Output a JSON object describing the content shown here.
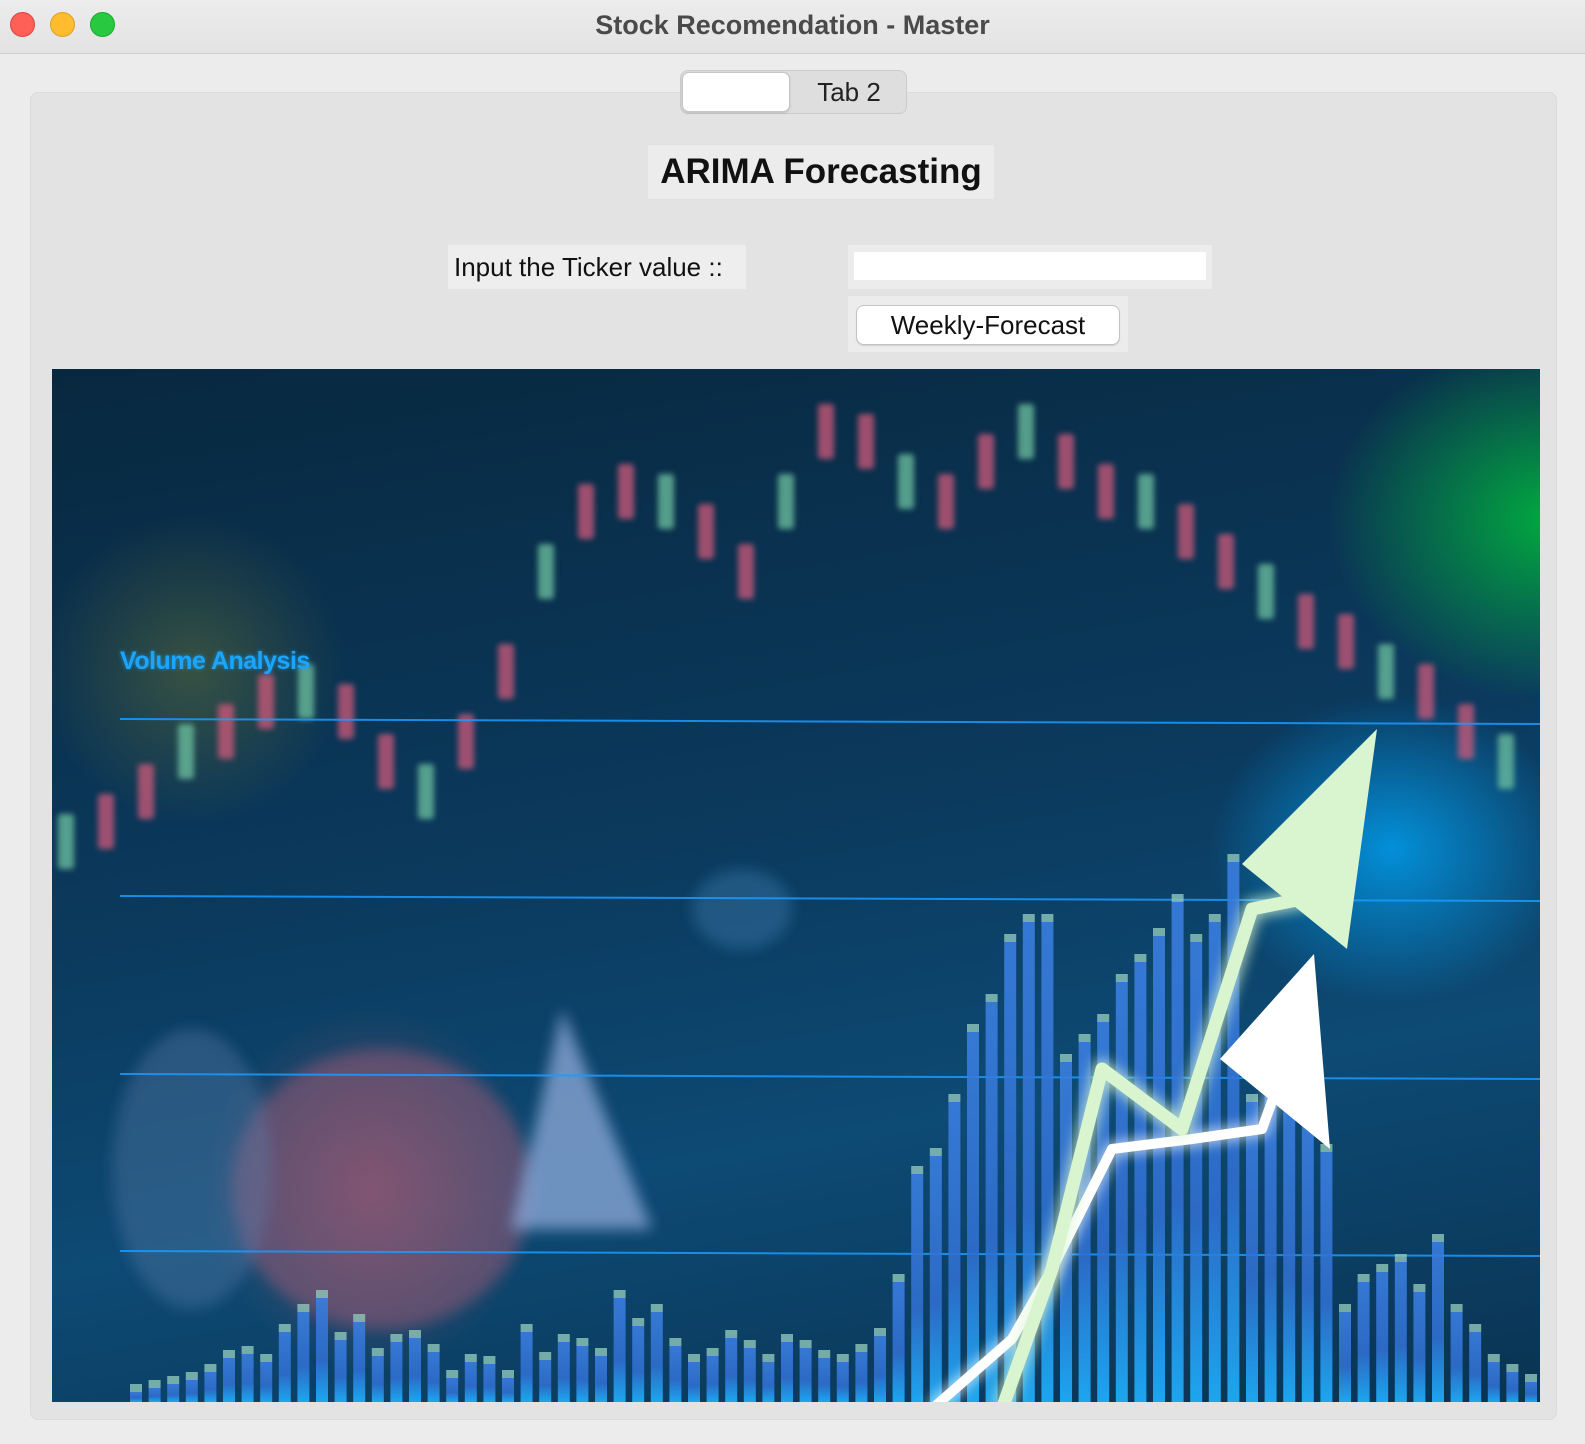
{
  "window": {
    "title": "Stock Recomendation - Master"
  },
  "tabs": [
    {
      "label": ""
    },
    {
      "label": "Tab 2"
    }
  ],
  "main": {
    "heading": "ARIMA Forecasting",
    "ticker_label": "Input the Ticker value ::",
    "ticker_value": "",
    "forecast_button_label": "Weekly-Forecast"
  },
  "hero_image": {
    "caption": "Volume Analysis",
    "colors": {
      "background": "#0b3a5e",
      "bars": "#2f8fe6",
      "arrow_green": "#d8f5d0",
      "arrow_white": "#ffffff",
      "grid": "#1a9cff"
    }
  }
}
